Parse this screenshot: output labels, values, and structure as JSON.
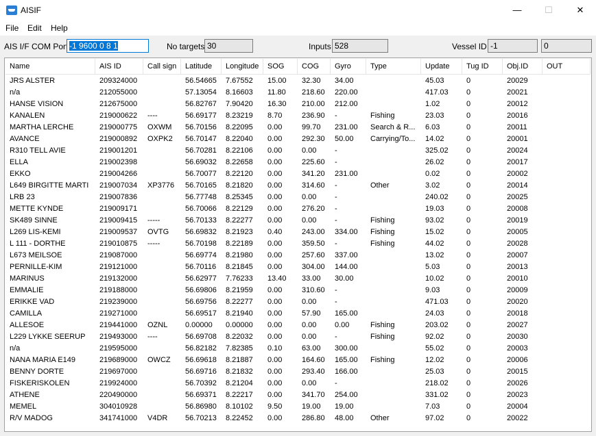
{
  "window": {
    "title": "AISIF",
    "minimize": "—",
    "maximize": "☐",
    "close": "✕"
  },
  "menu": [
    "File",
    "Edit",
    "Help"
  ],
  "toolbar": {
    "com_port_label": "AIS I/F  COM Port",
    "com_port_value": "-1 9600 0 8 1",
    "no_targets_label": "No targets",
    "no_targets_value": "30",
    "inputs_label": "Inputs",
    "inputs_value": "528",
    "vessel_id_label": "Vessel ID",
    "vessel_id_value": "-1",
    "extra_value": "0"
  },
  "table": {
    "columns": [
      "Name",
      "AIS ID",
      "Call sign",
      "Latitude",
      "Longitude",
      "SOG",
      "COG",
      "Gyro",
      "Type",
      "Update",
      "Tug ID",
      "Obj.ID",
      "OUT"
    ],
    "rows": [
      [
        "JRS ALSTER",
        "209324000",
        "",
        "56.54665",
        "7.67552",
        "15.00",
        "32.30",
        "34.00",
        "",
        "45.03",
        "0",
        "20029",
        ""
      ],
      [
        "n/a",
        "212055000",
        "",
        "57.13054",
        "8.16603",
        "11.80",
        "218.60",
        "220.00",
        "",
        "417.03",
        "0",
        "20021",
        ""
      ],
      [
        "HANSE VISION",
        "212675000",
        "",
        "56.82767",
        "7.90420",
        "16.30",
        "210.00",
        "212.00",
        "",
        "1.02",
        "0",
        "20012",
        ""
      ],
      [
        "KANALEN",
        "219000622",
        "----",
        "56.69177",
        "8.23219",
        "8.70",
        "236.90",
        "-",
        "Fishing",
        "23.03",
        "0",
        "20016",
        ""
      ],
      [
        "MARTHA LERCHE",
        "219000775",
        "OXWM",
        "56.70156",
        "8.22095",
        "0.00",
        "99.70",
        "231.00",
        "Search & R...",
        "6.03",
        "0",
        "20011",
        ""
      ],
      [
        "AVANCE",
        "219000892",
        "OXPK2",
        "56.70147",
        "8.22040",
        "0.00",
        "292.30",
        "50.00",
        "Carrying/To...",
        "14.02",
        "0",
        "20001",
        ""
      ],
      [
        "R310 TELL AVIE",
        "219001201",
        "",
        "56.70281",
        "8.22106",
        "0.00",
        "0.00",
        "-",
        "",
        "325.02",
        "0",
        "20024",
        ""
      ],
      [
        "ELLA",
        "219002398",
        "",
        "56.69032",
        "8.22658",
        "0.00",
        "225.60",
        "-",
        "",
        "26.02",
        "0",
        "20017",
        ""
      ],
      [
        "EKKO",
        "219004266",
        "",
        "56.70077",
        "8.22120",
        "0.00",
        "341.20",
        "231.00",
        "",
        "0.02",
        "0",
        "20002",
        ""
      ],
      [
        "L649 BIRGITTE MARTI",
        "219007034",
        "XP3776",
        "56.70165",
        "8.21820",
        "0.00",
        "314.60",
        "-",
        "Other",
        "3.02",
        "0",
        "20014",
        ""
      ],
      [
        "LRB 23",
        "219007836",
        "",
        "56.77748",
        "8.25345",
        "0.00",
        "0.00",
        "-",
        "",
        "240.02",
        "0",
        "20025",
        ""
      ],
      [
        "METTE KYNDE",
        "219009171",
        "",
        "56.70066",
        "8.22129",
        "0.00",
        "276.20",
        "-",
        "",
        "19.03",
        "0",
        "20008",
        ""
      ],
      [
        "SK489 SINNE",
        "219009415",
        "-----",
        "56.70133",
        "8.22277",
        "0.00",
        "0.00",
        "-",
        "Fishing",
        "93.02",
        "0",
        "20019",
        ""
      ],
      [
        "L269 LIS-KEMI",
        "219009537",
        "OVTG",
        "56.69832",
        "8.21923",
        "0.40",
        "243.00",
        "334.00",
        "Fishing",
        "15.02",
        "0",
        "20005",
        ""
      ],
      [
        "L 111 - DORTHE",
        "219010875",
        "-----",
        "56.70198",
        "8.22189",
        "0.00",
        "359.50",
        "-",
        "Fishing",
        "44.02",
        "0",
        "20028",
        ""
      ],
      [
        "L673 MEILSOE",
        "219087000",
        "",
        "56.69774",
        "8.21980",
        "0.00",
        "257.60",
        "337.00",
        "",
        "13.02",
        "0",
        "20007",
        ""
      ],
      [
        "PERNILLE-KIM",
        "219121000",
        "",
        "56.70116",
        "8.21845",
        "0.00",
        "304.00",
        "144.00",
        "",
        "5.03",
        "0",
        "20013",
        ""
      ],
      [
        "MARINUS",
        "219132000",
        "",
        "56.62977",
        "7.76233",
        "13.40",
        "33.00",
        "30.00",
        "",
        "10.02",
        "0",
        "20010",
        ""
      ],
      [
        "EMMALIE",
        "219188000",
        "",
        "56.69806",
        "8.21959",
        "0.00",
        "310.60",
        "-",
        "",
        "9.03",
        "0",
        "20009",
        ""
      ],
      [
        "ERIKKE VAD",
        "219239000",
        "",
        "56.69756",
        "8.22277",
        "0.00",
        "0.00",
        "-",
        "",
        "471.03",
        "0",
        "20020",
        ""
      ],
      [
        "CAMILLA",
        "219271000",
        "",
        "56.69517",
        "8.21940",
        "0.00",
        "57.90",
        "165.00",
        "",
        "24.03",
        "0",
        "20018",
        ""
      ],
      [
        "ALLESOE",
        "219441000",
        "OZNL",
        "0.00000",
        "0.00000",
        "0.00",
        "0.00",
        "0.00",
        "Fishing",
        "203.02",
        "0",
        "20027",
        ""
      ],
      [
        "L229 LYKKE SEERUP",
        "219493000",
        "----",
        "56.69708",
        "8.22032",
        "0.00",
        "0.00",
        "-",
        "Fishing",
        "92.02",
        "0",
        "20030",
        ""
      ],
      [
        "n/a",
        "219595000",
        "",
        "56.82182",
        "7.82385",
        "0.10",
        "63.00",
        "300.00",
        "",
        "55.02",
        "0",
        "20003",
        ""
      ],
      [
        "NANA MARIA E149",
        "219689000",
        "OWCZ",
        "56.69618",
        "8.21887",
        "0.00",
        "164.60",
        "165.00",
        "Fishing",
        "12.02",
        "0",
        "20006",
        ""
      ],
      [
        "BENNY DORTE",
        "219697000",
        "",
        "56.69716",
        "8.21832",
        "0.00",
        "293.40",
        "166.00",
        "",
        "25.03",
        "0",
        "20015",
        ""
      ],
      [
        "FISKERISKOLEN",
        "219924000",
        "",
        "56.70392",
        "8.21204",
        "0.00",
        "0.00",
        "-",
        "",
        "218.02",
        "0",
        "20026",
        ""
      ],
      [
        "ATHENE",
        "220490000",
        "",
        "56.69371",
        "8.22217",
        "0.00",
        "341.70",
        "254.00",
        "",
        "331.02",
        "0",
        "20023",
        ""
      ],
      [
        "MEMEL",
        "304010928",
        "",
        "56.86980",
        "8.10102",
        "9.50",
        "19.00",
        "19.00",
        "",
        "7.03",
        "0",
        "20004",
        ""
      ],
      [
        "R/V MADOG",
        "341741000",
        "V4DR",
        "56.70213",
        "8.22452",
        "0.00",
        "286.80",
        "48.00",
        "Other",
        "97.02",
        "0",
        "20022",
        ""
      ]
    ]
  }
}
